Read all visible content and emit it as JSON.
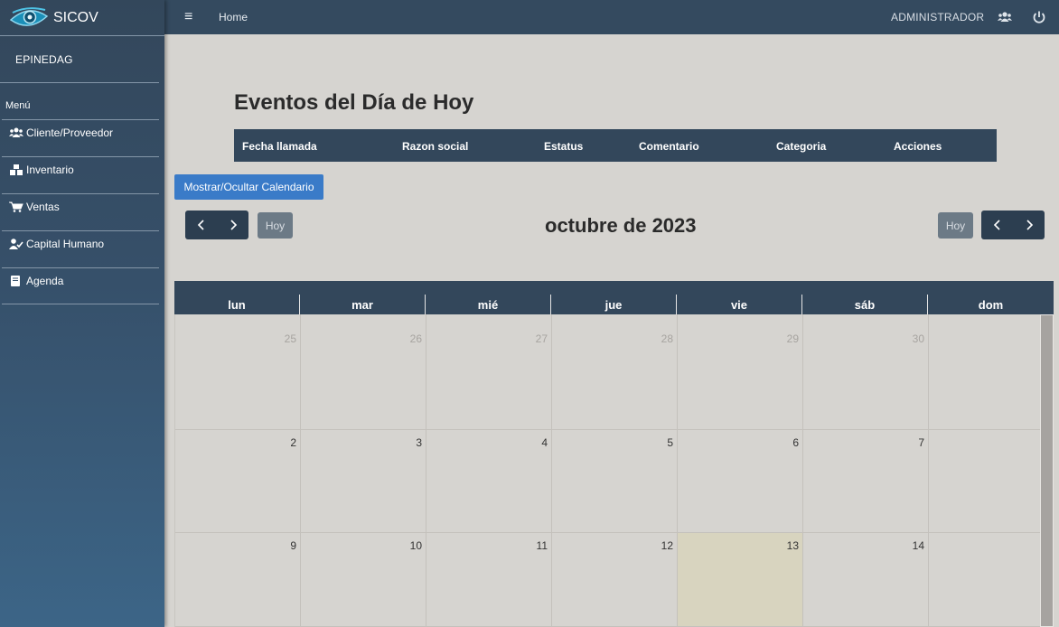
{
  "app": {
    "name": "SICOV",
    "logo_icon": "eye-logo-icon"
  },
  "sidebar": {
    "user": "EPINEDAG",
    "menu_header": "Menú",
    "items": [
      {
        "label": "Cliente/Proveedor",
        "icon": "users-icon"
      },
      {
        "label": "Inventario",
        "icon": "boxes-icon"
      },
      {
        "label": "Ventas",
        "icon": "cart-icon"
      },
      {
        "label": "Capital Humano",
        "icon": "user-check-icon"
      },
      {
        "label": "Agenda",
        "icon": "book-icon"
      }
    ]
  },
  "topbar": {
    "menu_icon": "≡",
    "breadcrumb": "Home",
    "user_role": "ADMINISTRADOR",
    "icons": [
      "users-icon",
      "power-icon"
    ]
  },
  "events": {
    "title": "Eventos del Día de Hoy",
    "columns": [
      "Fecha llamada",
      "Razon social",
      "Estatus",
      "Comentario",
      "Categoria",
      "Acciones"
    ]
  },
  "calendar": {
    "toggle_label": "Mostrar/Ocultar Calendario",
    "today_label": "Hoy",
    "month_title": "octubre de 2023",
    "weekdays": [
      "lun",
      "mar",
      "mié",
      "jue",
      "vie",
      "sáb",
      "dom"
    ],
    "weeks": [
      [
        {
          "n": "25",
          "other": true
        },
        {
          "n": "26",
          "other": true
        },
        {
          "n": "27",
          "other": true
        },
        {
          "n": "28",
          "other": true
        },
        {
          "n": "29",
          "other": true
        },
        {
          "n": "30",
          "other": true
        },
        {
          "n": "",
          "other": false
        }
      ],
      [
        {
          "n": "2"
        },
        {
          "n": "3"
        },
        {
          "n": "4"
        },
        {
          "n": "5"
        },
        {
          "n": "6"
        },
        {
          "n": "7"
        },
        {
          "n": ""
        }
      ],
      [
        {
          "n": "9"
        },
        {
          "n": "10"
        },
        {
          "n": "11"
        },
        {
          "n": "12"
        },
        {
          "n": "13",
          "today": true
        },
        {
          "n": "14"
        },
        {
          "n": ""
        }
      ]
    ],
    "colors": {
      "header": "#33475b",
      "today": "#d8d4bf",
      "button": "#3a7bc8"
    }
  }
}
